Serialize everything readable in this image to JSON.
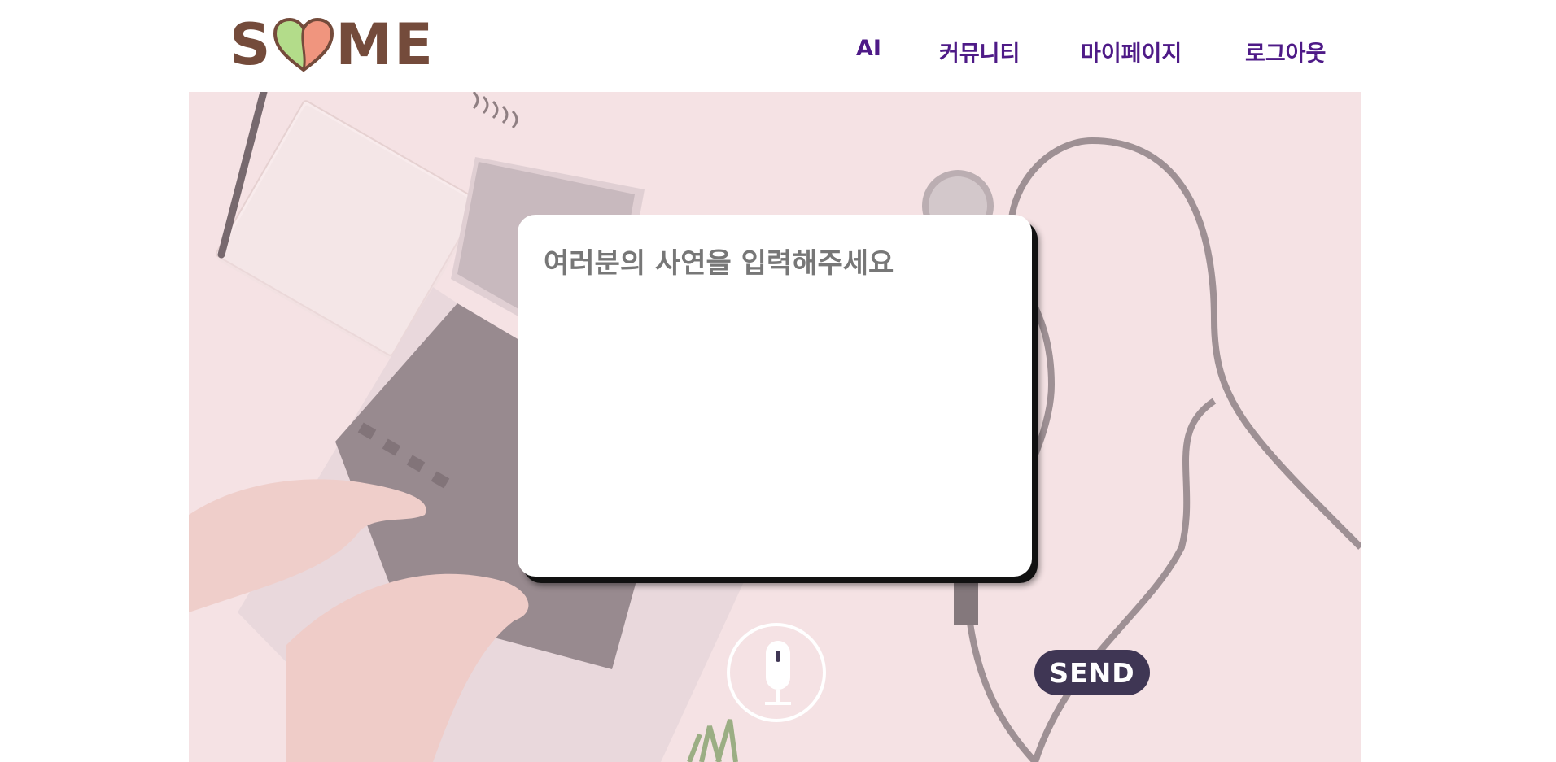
{
  "app": {
    "logo_text": "S♥ME",
    "logo_letter_s": "S",
    "logo_letters_me": "ME"
  },
  "nav": {
    "items": [
      {
        "label": "AI"
      },
      {
        "label": "커뮤니티"
      },
      {
        "label": "마이페이지"
      },
      {
        "label": "로그아웃"
      }
    ]
  },
  "composer": {
    "placeholder": "여러분의 사연을 입력해주세요",
    "value": "",
    "send_label": "SEND",
    "mic_icon": "microphone-icon"
  },
  "colors": {
    "brand_brown": "#744b3b",
    "nav_purple": "#4e1a87",
    "send_button": "#3f3654",
    "hero_tint": "#f4e1e2"
  }
}
